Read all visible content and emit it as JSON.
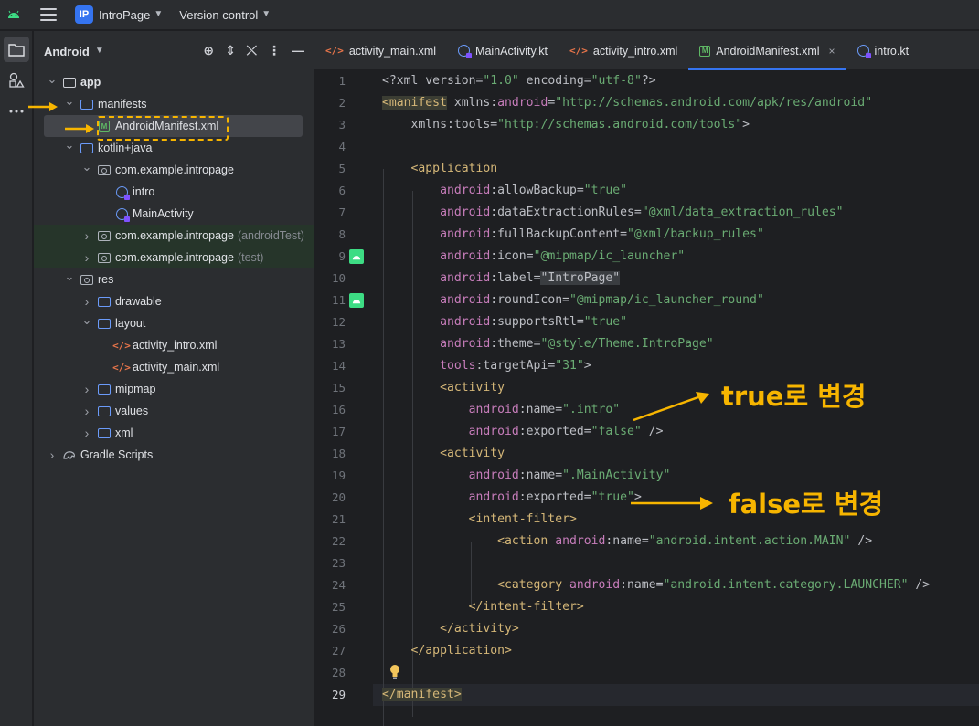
{
  "topbar": {
    "project_badge": "IP",
    "project_name": "IntroPage",
    "version_control": "Version control"
  },
  "project_panel": {
    "title": "Android",
    "tree": [
      {
        "label": "app",
        "depth": 0,
        "expanded": true,
        "icon": "module-folder-icon"
      },
      {
        "label": "manifests",
        "depth": 1,
        "expanded": true,
        "icon": "folder-icon"
      },
      {
        "label": "AndroidManifest.xml",
        "depth": 2,
        "icon": "manifest-file-icon",
        "selected": true
      },
      {
        "label": "kotlin+java",
        "depth": 1,
        "expanded": true,
        "icon": "folder-icon"
      },
      {
        "label": "com.example.intropage",
        "depth": 2,
        "expanded": true,
        "icon": "package-icon"
      },
      {
        "label": "intro",
        "depth": 3,
        "icon": "kotlin-class-icon"
      },
      {
        "label": "MainActivity",
        "depth": 3,
        "icon": "kotlin-class-icon"
      },
      {
        "label": "com.example.intropage",
        "suffix": "(androidTest)",
        "depth": 2,
        "expanded": false,
        "icon": "package-icon"
      },
      {
        "label": "com.example.intropage",
        "suffix": "(test)",
        "depth": 2,
        "expanded": false,
        "icon": "package-icon"
      },
      {
        "label": "res",
        "depth": 1,
        "expanded": true,
        "icon": "res-folder-icon"
      },
      {
        "label": "drawable",
        "depth": 2,
        "expanded": false,
        "icon": "folder-icon"
      },
      {
        "label": "layout",
        "depth": 2,
        "expanded": true,
        "icon": "folder-icon"
      },
      {
        "label": "activity_intro.xml",
        "depth": 3,
        "icon": "xml-file-icon"
      },
      {
        "label": "activity_main.xml",
        "depth": 3,
        "icon": "xml-file-icon"
      },
      {
        "label": "mipmap",
        "depth": 2,
        "expanded": false,
        "icon": "folder-icon"
      },
      {
        "label": "values",
        "depth": 2,
        "expanded": false,
        "icon": "folder-icon"
      },
      {
        "label": "xml",
        "depth": 2,
        "expanded": false,
        "icon": "folder-icon"
      },
      {
        "label": "Gradle Scripts",
        "depth": 0,
        "expanded": false,
        "icon": "gradle-icon"
      }
    ]
  },
  "tabs": [
    {
      "label": "activity_main.xml",
      "icon": "xml-file-icon"
    },
    {
      "label": "MainActivity.kt",
      "icon": "kotlin-class-icon"
    },
    {
      "label": "activity_intro.xml",
      "icon": "xml-file-icon"
    },
    {
      "label": "AndroidManifest.xml",
      "icon": "manifest-file-icon",
      "active": true,
      "close": "×"
    },
    {
      "label": "intro.kt",
      "icon": "kotlin-class-icon"
    }
  ],
  "editor": {
    "line_numbers": [
      "1",
      "2",
      "3",
      "4",
      "5",
      "6",
      "7",
      "8",
      "9",
      "10",
      "11",
      "12",
      "13",
      "14",
      "15",
      "16",
      "17",
      "18",
      "19",
      "20",
      "21",
      "22",
      "23",
      "24",
      "25",
      "26",
      "27",
      "28",
      "29"
    ],
    "current_line": 29,
    "lines": [
      [
        [
          "pn",
          "<?xml version="
        ],
        [
          "st",
          "\"1.0\""
        ],
        [
          "pn",
          " encoding="
        ],
        [
          "st",
          "\"utf-8\""
        ],
        [
          "pn",
          "?>"
        ]
      ],
      [
        [
          "tg",
          "<manifest"
        ],
        [
          "at",
          " xmlns:"
        ],
        [
          "ns",
          "android"
        ],
        [
          "pn",
          "="
        ],
        [
          "st",
          "\"http://schemas.android.com/apk/res/android\""
        ]
      ],
      [
        [
          "at",
          "    xmlns:tools"
        ],
        [
          "pn",
          "="
        ],
        [
          "st",
          "\"http://schemas.android.com/tools\""
        ],
        [
          "pn",
          ">"
        ]
      ],
      [],
      [
        [
          "t",
          "    <application"
        ]
      ],
      [
        [
          "ns",
          "        android"
        ],
        [
          "at",
          ":allowBackup"
        ],
        [
          "pn",
          "="
        ],
        [
          "st",
          "\"true\""
        ]
      ],
      [
        [
          "ns",
          "        android"
        ],
        [
          "at",
          ":dataExtractionRules"
        ],
        [
          "pn",
          "="
        ],
        [
          "st",
          "\"@xml/data_extraction_rules\""
        ]
      ],
      [
        [
          "ns",
          "        android"
        ],
        [
          "at",
          ":fullBackupContent"
        ],
        [
          "pn",
          "="
        ],
        [
          "st",
          "\"@xml/backup_rules\""
        ]
      ],
      [
        [
          "ns",
          "        android"
        ],
        [
          "at",
          ":icon"
        ],
        [
          "pn",
          "="
        ],
        [
          "st",
          "\"@mipmap/ic_launcher\""
        ]
      ],
      [
        [
          "ns",
          "        android"
        ],
        [
          "at",
          ":label"
        ],
        [
          "pn",
          "="
        ],
        [
          "lbl",
          "\"IntroPage\""
        ]
      ],
      [
        [
          "ns",
          "        android"
        ],
        [
          "at",
          ":roundIcon"
        ],
        [
          "pn",
          "="
        ],
        [
          "st",
          "\"@mipmap/ic_launcher_round\""
        ]
      ],
      [
        [
          "ns",
          "        android"
        ],
        [
          "at",
          ":supportsRtl"
        ],
        [
          "pn",
          "="
        ],
        [
          "st",
          "\"true\""
        ]
      ],
      [
        [
          "ns",
          "        android"
        ],
        [
          "at",
          ":theme"
        ],
        [
          "pn",
          "="
        ],
        [
          "st",
          "\"@style/Theme.IntroPage\""
        ]
      ],
      [
        [
          "ns",
          "        tools"
        ],
        [
          "at",
          ":targetApi"
        ],
        [
          "pn",
          "="
        ],
        [
          "st",
          "\"31\""
        ],
        [
          "pn",
          ">"
        ]
      ],
      [
        [
          "t",
          "        <activity"
        ]
      ],
      [
        [
          "ns",
          "            android"
        ],
        [
          "at",
          ":name"
        ],
        [
          "pn",
          "="
        ],
        [
          "st",
          "\".intro\""
        ]
      ],
      [
        [
          "ns",
          "            android"
        ],
        [
          "at",
          ":exported"
        ],
        [
          "pn",
          "="
        ],
        [
          "st",
          "\"false\""
        ],
        [
          "pn",
          " />"
        ]
      ],
      [
        [
          "t",
          "        <activity"
        ]
      ],
      [
        [
          "ns",
          "            android"
        ],
        [
          "at",
          ":name"
        ],
        [
          "pn",
          "="
        ],
        [
          "st",
          "\".MainActivity\""
        ]
      ],
      [
        [
          "ns",
          "            android"
        ],
        [
          "at",
          ":exported"
        ],
        [
          "pn",
          "="
        ],
        [
          "st",
          "\"true\""
        ],
        [
          "pn",
          ">"
        ]
      ],
      [
        [
          "t",
          "            <intent-filter>"
        ]
      ],
      [
        [
          "t",
          "                <action"
        ],
        [
          "ns",
          " android"
        ],
        [
          "at",
          ":name"
        ],
        [
          "pn",
          "="
        ],
        [
          "st",
          "\"android.intent.action.MAIN\""
        ],
        [
          "pn",
          " />"
        ]
      ],
      [],
      [
        [
          "t",
          "                <category"
        ],
        [
          "ns",
          " android"
        ],
        [
          "at",
          ":name"
        ],
        [
          "pn",
          "="
        ],
        [
          "st",
          "\"android.intent.category.LAUNCHER\""
        ],
        [
          "pn",
          " />"
        ]
      ],
      [
        [
          "t",
          "            </intent-filter>"
        ]
      ],
      [
        [
          "t",
          "        </activity>"
        ]
      ],
      [
        [
          "t",
          "    </application>"
        ]
      ],
      [],
      [
        [
          "tg",
          "</manifest>"
        ]
      ]
    ]
  },
  "annotations": {
    "change_to_true": "true로 변경",
    "change_to_false": "false로 변경"
  },
  "colors": {
    "accent": "#3574f0",
    "annotation": "#f7b500",
    "string": "#6aab73",
    "tag": "#d5b778",
    "namespace": "#c77dbb"
  }
}
